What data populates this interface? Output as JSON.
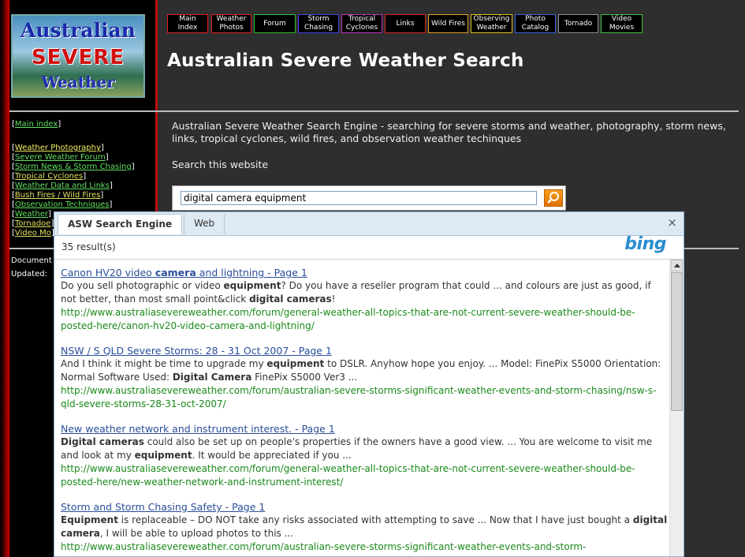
{
  "logo": {
    "line1": "Australian",
    "line2": "SEVERE",
    "line3": "Weather"
  },
  "nav": [
    {
      "label": "Main Index",
      "color": "#e02020"
    },
    {
      "label": "Weather Photos",
      "color": "#e02020"
    },
    {
      "label": "Forum",
      "color": "#30c030"
    },
    {
      "label": "Storm Chasing",
      "color": "#4040e0"
    },
    {
      "label": "Tropical Cyclones",
      "color": "#c030c0"
    },
    {
      "label": "Links",
      "color": "#e02020"
    },
    {
      "label": "Wild Fires",
      "color": "#e0a020"
    },
    {
      "label": "Observing Weather",
      "color": "#e0c020"
    },
    {
      "label": "Photo Catalog",
      "color": "#4060e0"
    },
    {
      "label": "Tornado",
      "color": "#909090"
    },
    {
      "label": "Video Movies",
      "color": "#40c040"
    }
  ],
  "page_title": "Australian Severe Weather Search",
  "sidebar": {
    "main_index": "Main index",
    "links": [
      {
        "label": "Weather Photography",
        "color": "#f0f060"
      },
      {
        "label": "Severe Weather Forum",
        "color": "#60e060"
      },
      {
        "label": "Storm News & Storm Chasing",
        "color": "#60e060"
      },
      {
        "label": "Tropical Cyclones",
        "color": "#e0e060"
      },
      {
        "label": "Weather Data and Links",
        "color": "#60e060"
      },
      {
        "label": "Bush Fires / Wild Fires",
        "color": "#e0e060"
      },
      {
        "label": "Observation Techniques",
        "color": "#60e060"
      },
      {
        "label": "Weather",
        "color": "#60e060"
      },
      {
        "label": "Tornadoe",
        "color": "#e0e060"
      },
      {
        "label": "Video Mo",
        "color": "#e0e060"
      }
    ],
    "document_label": "Document",
    "updated_label": "Updated:"
  },
  "intro": "Australian Severe Weather Search Engine - searching for severe storms and weather, photography, storm news, links, tropical cyclones, wild fires, and observation weather techinques",
  "search": {
    "label": "Search this website",
    "value": "digital camera equipment"
  },
  "overlay": {
    "tabs": [
      "ASW Search Engine",
      "Web"
    ],
    "close": "×",
    "count": "35 result(s)",
    "brand": "bing",
    "results": [
      {
        "title": "Canon HV20 video camera and lightning - Page 1",
        "snippet": "Do you sell photographic or video equipment? Do you have a reseller program that could ... and colours are just as good, if not better, than most small point&click digital cameras!",
        "url": "http://www.australiasevereweather.com/forum/general-weather-all-topics-that-are-not-current-severe-weather-should-be-posted-here/canon-hv20-video-camera-and-lightning/"
      },
      {
        "title": "NSW / S QLD Severe Storms: 28 - 31 Oct 2007 - Page 1",
        "snippet": "And I think it might be time to upgrade my equipment to DSLR. Anyhow hope you enjoy. ... Model: FinePix S5000 Orientation: Normal Software Used: Digital Camera FinePix S5000 Ver3 ...",
        "url": "http://www.australiasevereweather.com/forum/australian-severe-storms-significant-weather-events-and-storm-chasing/nsw-s-qld-severe-storms-28-31-oct-2007/"
      },
      {
        "title": "New weather network and instrument interest. - Page 1",
        "snippet": "Digital cameras could also be set up on people's properties if the owners have a good view. ... You are welcome to visit me and look at my equipment. It would be appreciated if you ...",
        "url": "http://www.australiasevereweather.com/forum/general-weather-all-topics-that-are-not-current-severe-weather-should-be-posted-here/new-weather-network-and-instrument-interest/"
      },
      {
        "title": "Storm and Storm Chasing Safety - Page 1",
        "snippet": "Equipment is replaceable – DO NOT take any risks associated with attempting to save ... Now that I have just bought a digital camera, I will be able to upload photos to this ...",
        "url": "http://www.australiasevereweather.com/forum/australian-severe-storms-significant-weather-events-and-storm-"
      }
    ]
  }
}
